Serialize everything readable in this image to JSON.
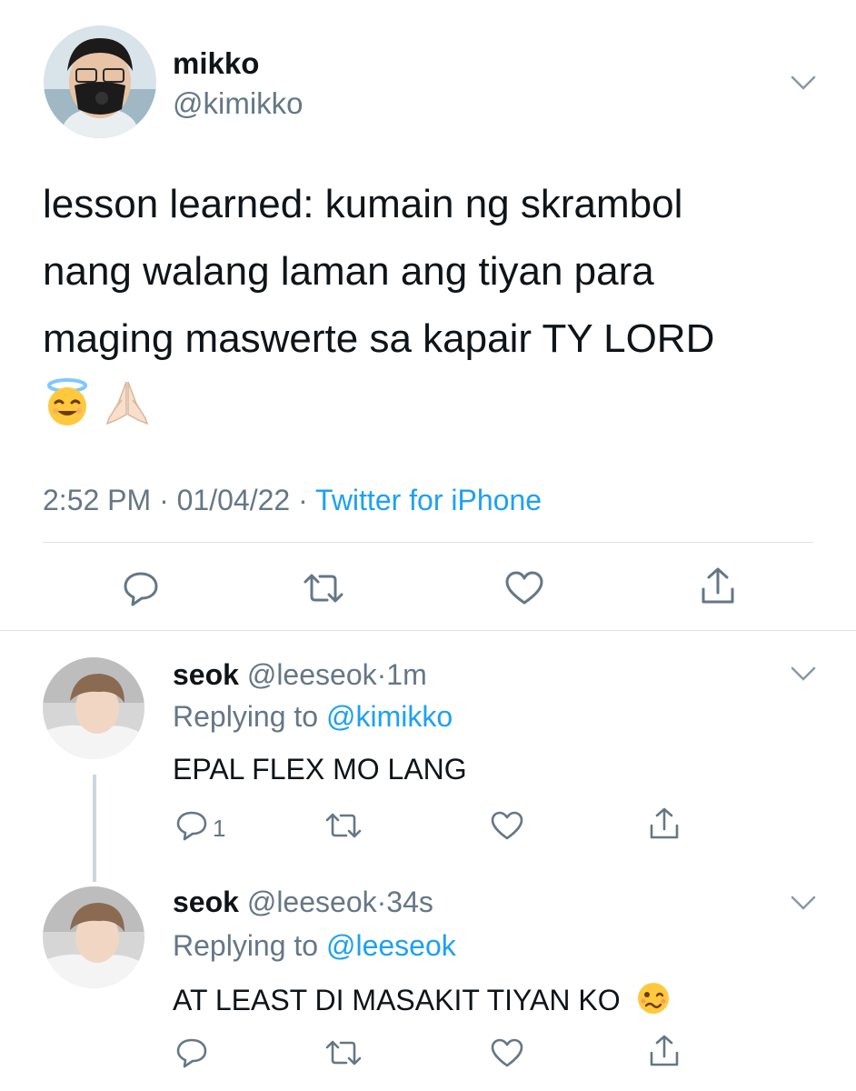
{
  "main_tweet": {
    "display_name": "mikko",
    "handle": "@kimikko",
    "text_lines": [
      "lesson learned: kumain ng skrambol",
      "nang walang laman ang tiyan para",
      "maging maswerte sa kapair TY LORD"
    ],
    "emoji_names": [
      "smiling-face-with-halo",
      "folded-hands"
    ],
    "time": "2:52 PM",
    "date": "01/04/22",
    "source": "Twitter for iPhone",
    "dot": "·"
  },
  "replies": [
    {
      "display_name": "seok",
      "handle": "@leeseok",
      "age": "1m",
      "replying_label": "Replying to",
      "replying_to": "@kimikko",
      "text": "EPAL FLEX MO LANG",
      "reply_count": "1"
    },
    {
      "display_name": "seok",
      "handle": "@leeseok",
      "age": "34s",
      "replying_label": "Replying to",
      "replying_to": "@leeseok",
      "text": "AT LEAST DI MASAKIT TIYAN KO",
      "emoji_name": "woozy-face"
    }
  ],
  "colors": {
    "accent": "#1da1f2",
    "secondary_text": "#657786",
    "primary_text": "#0f1419",
    "divider": "#dde3e8"
  },
  "icons": [
    "chevron-down-icon",
    "reply-icon",
    "retweet-icon",
    "like-icon",
    "share-icon"
  ]
}
